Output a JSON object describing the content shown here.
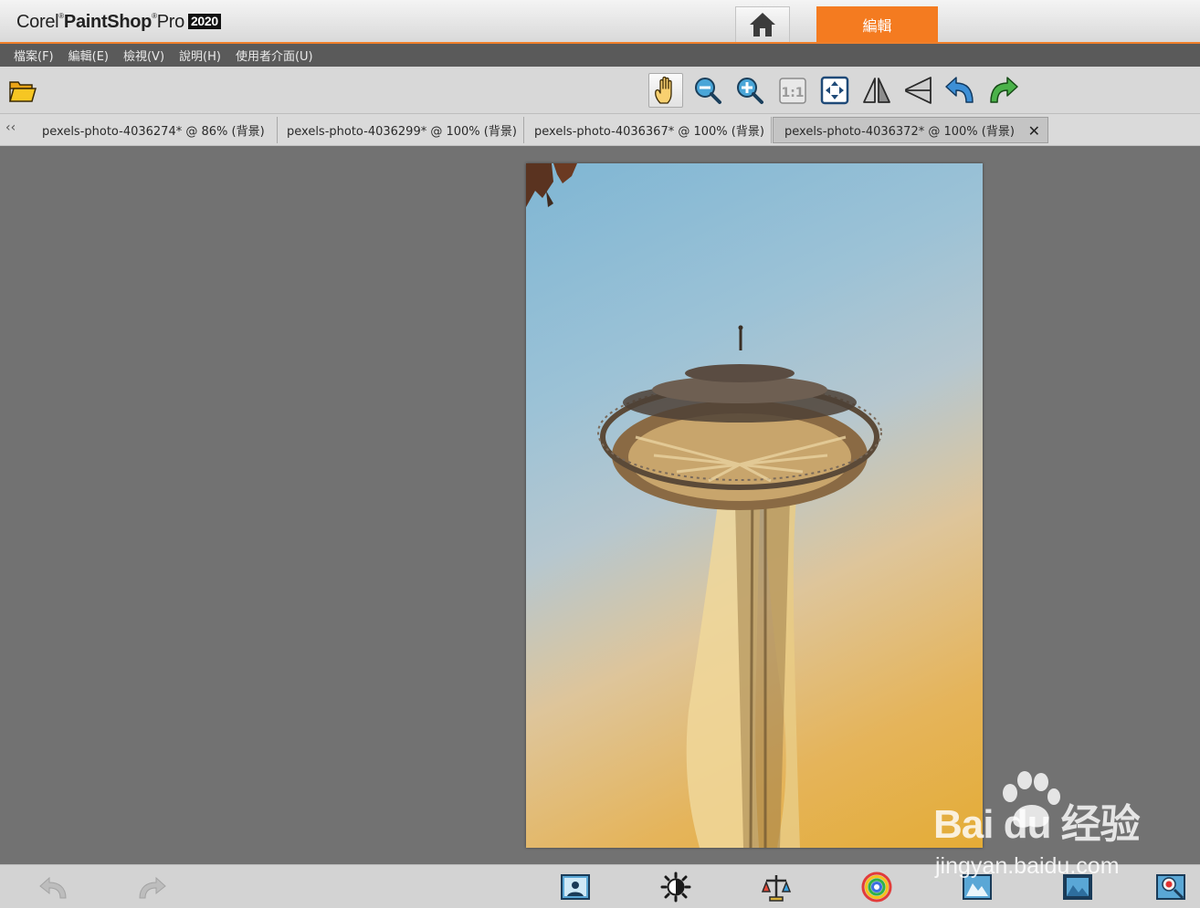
{
  "app": {
    "brand_corel": "Corel",
    "brand_paintshop": "PaintShop",
    "brand_pro": "Pro",
    "brand_year": "2020",
    "edit_tab_label": "編輯"
  },
  "menu": [
    "檔案(F)",
    "編輯(E)",
    "檢視(V)",
    "說明(H)",
    "使用者介面(U)"
  ],
  "tabs": [
    {
      "name": "pexels-photo-4036274*",
      "zoom": "86%",
      "layer": "(背景)"
    },
    {
      "name": "pexels-photo-4036299*",
      "zoom": "100%",
      "layer": "(背景)"
    },
    {
      "name": "pexels-photo-4036367*",
      "zoom": "100%",
      "layer": "(背景)"
    },
    {
      "name": "pexels-photo-4036372*",
      "zoom": "100%",
      "layer": "(背景)"
    }
  ],
  "tab_text": [
    "pexels-photo-4036274* @  86% (背景)",
    "pexels-photo-4036299* @ 100% (背景)",
    "pexels-photo-4036367* @ 100% (背景)",
    "pexels-photo-4036372* @ 100% (背景)"
  ],
  "toolbar_icons": [
    "open-folder-icon",
    "pan-hand-icon",
    "zoom-out-icon",
    "zoom-in-icon",
    "actual-size-icon",
    "fit-to-window-icon",
    "flip-horizontal-icon",
    "flip-vertical-icon",
    "rotate-left-icon",
    "rotate-right-icon"
  ],
  "actual_size_label": "1:1",
  "bottom_icons": [
    "undo-icon",
    "redo-icon",
    "smart-photo-fix-icon",
    "brightness-icon",
    "white-balance-icon",
    "color-balance-icon",
    "straighten-icon",
    "crop-icon",
    "red-eye-icon"
  ],
  "watermark": {
    "main": "Bai  du 经验",
    "sub": "jingyan.baidu.com"
  },
  "colors": {
    "accent": "#f47b20",
    "menubar": "#5a5a5a",
    "workspace": "#727272"
  }
}
